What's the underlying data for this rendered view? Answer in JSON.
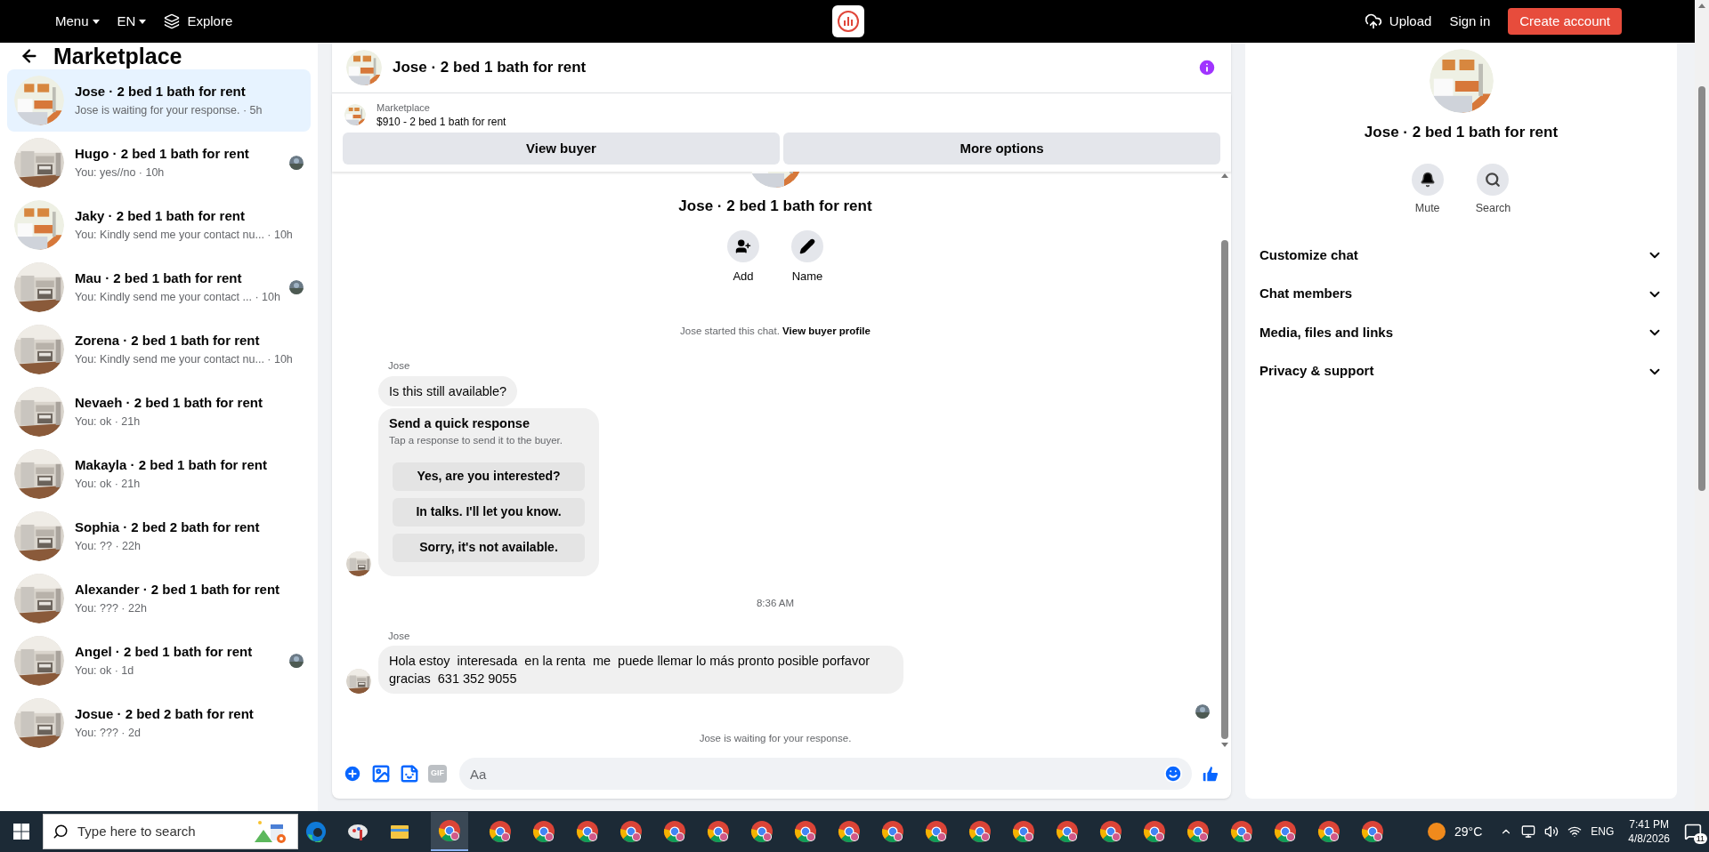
{
  "topbar": {
    "menu": "Menu",
    "language": "EN",
    "explore": "Explore",
    "upload": "Upload",
    "sign_in": "Sign in",
    "create_account": "Create account"
  },
  "sidebar": {
    "title": "Marketplace",
    "conversations": [
      {
        "title": "Jose · 2 bed 1 bath for rent",
        "preview": "Jose is waiting for your response. · 5h",
        "selected": true,
        "read_receipt": false
      },
      {
        "title": "Hugo · 2 bed 1 bath for rent",
        "preview": "You: yes//no · 10h",
        "selected": false,
        "read_receipt": true
      },
      {
        "title": "Jaky · 2 bed 1 bath for rent",
        "preview": "You: Kindly send me your contact nu... · 10h",
        "selected": false,
        "read_receipt": false
      },
      {
        "title": "Mau · 2 bed 1 bath for rent",
        "preview": "You: Kindly send me your contact ... · 10h",
        "selected": false,
        "read_receipt": true
      },
      {
        "title": "Zorena · 2 bed 1 bath for rent",
        "preview": "You: Kindly send me your contact nu... · 10h",
        "selected": false,
        "read_receipt": false
      },
      {
        "title": "Nevaeh · 2 bed 1 bath for rent",
        "preview": "You: ok · 21h",
        "selected": false,
        "read_receipt": false
      },
      {
        "title": "Makayla · 2 bed 1 bath for rent",
        "preview": "You: ok · 21h",
        "selected": false,
        "read_receipt": false
      },
      {
        "title": "Sophia · 2 bed 2 bath for rent",
        "preview": "You: ?? · 22h",
        "selected": false,
        "read_receipt": false
      },
      {
        "title": "Alexander · 2 bed 1 bath for rent",
        "preview": "You: ??? · 22h",
        "selected": false,
        "read_receipt": false
      },
      {
        "title": "Angel · 2 bed 1 bath for rent",
        "preview": "You: ok · 1d",
        "selected": false,
        "read_receipt": true
      },
      {
        "title": "Josue · 2 bed 2 bath for rent",
        "preview": "You: ??? · 2d",
        "selected": false,
        "read_receipt": false
      }
    ]
  },
  "chat": {
    "title": "Jose · 2 bed 1 bath for rent",
    "listing": {
      "source": "Marketplace",
      "name": "$910 - 2 bed 1 bath for rent"
    },
    "buttons": [
      "View buyer",
      "More options"
    ],
    "intro": {
      "title": "Jose · 2 bed 1 bath for rent",
      "actions": [
        "Add",
        "Name"
      ],
      "notice": "Jose started this chat.",
      "link": "View buyer profile"
    },
    "messages": [
      {
        "kind": "sender",
        "text": "Jose"
      },
      {
        "kind": "bubble",
        "text": "Is this still available?"
      },
      {
        "kind": "quick_response",
        "title": "Send a quick response",
        "hint": "Tap a response to send it to the buyer.",
        "options": [
          "Yes, are you interested?",
          "In talks. I'll let you know.",
          "Sorry, it's not available."
        ]
      },
      {
        "kind": "time",
        "text": "8:36 AM"
      },
      {
        "kind": "sender",
        "text": "Jose"
      },
      {
        "kind": "bubble",
        "text": "Hola estoy  interesada  en la renta  me  puede llemar lo más pronto posible porfavor gracias  631 352 9055"
      },
      {
        "kind": "seen"
      },
      {
        "kind": "status",
        "text": "Jose is waiting for your response."
      }
    ],
    "composer": {
      "gif": "GIF",
      "placeholder": "Aa"
    }
  },
  "details": {
    "title": "Jose · 2 bed 1 bath for rent",
    "actions": [
      "Mute",
      "Search"
    ],
    "sections": [
      {
        "label": "Customize chat",
        "expanded": false
      },
      {
        "label": "Chat members",
        "expanded": false
      },
      {
        "label": "Media, files and links",
        "expanded": false
      },
      {
        "label": "Privacy & support",
        "expanded": false
      }
    ]
  },
  "taskbar": {
    "search_placeholder": "Type here to search",
    "weather": "29°C",
    "language": "ENG",
    "time": "7:41 PM",
    "date": "4/8/2026",
    "notifications": "11"
  }
}
